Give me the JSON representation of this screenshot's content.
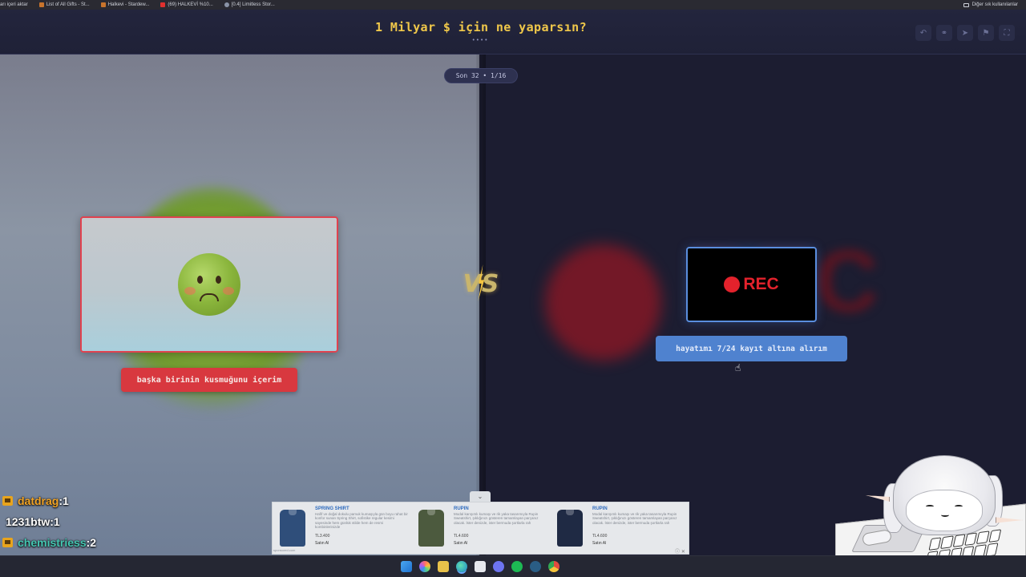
{
  "bookmarks": {
    "items": [
      "arı içeri aktar",
      "List of All Gifts - St...",
      "Halkevi - Stardew...",
      "(69) HALKEVİ %10...",
      "[0.4] Limitless Stor..."
    ],
    "other_label": "Diğer sık kullanılanlar"
  },
  "header": {
    "title": "1 Milyar $ için ne yaparsın?",
    "dots": "••••",
    "tools": [
      "undo-icon",
      "link-icon",
      "send-icon",
      "flag-icon",
      "fullscreen-icon"
    ],
    "tool_glyphs": [
      "↶",
      "⚭",
      "➤",
      "⚑",
      "⛶"
    ]
  },
  "progress": {
    "label": "Son 32 • 1/16"
  },
  "options": {
    "left": {
      "answer": "başka birinin kusmuğunu içerim",
      "image": "nauseated-face-emoji",
      "accent": "#d8383f"
    },
    "right": {
      "answer": "hayatımı 7/24 kayıt altına alırım",
      "image_text": "REC",
      "accent": "#4f82cf"
    }
  },
  "vs": {
    "label": "VS"
  },
  "chat": {
    "messages": [
      {
        "user": "datdrag",
        "sep": " : ",
        "count": "1",
        "badge": "crown-icon",
        "color": "#f2a425"
      },
      {
        "user": "1231btw",
        "sep": " : ",
        "count": "1",
        "badge": "",
        "color": "#ffffff"
      },
      {
        "user": "chemistriess",
        "sep": " : ",
        "count": "2",
        "badge": "crown-icon",
        "color": "#45c7b2"
      }
    ]
  },
  "ad": {
    "handle": "⌄",
    "items": [
      {
        "brand": "SPRING SHIRT",
        "desc": "Hafif ve doğal dokulu pamuk kumaşıyla gün boyu rahat bir konfor sunan Spring Shirt, sofistike regular kesimi sayesinde hem günlük stilde hem de resmi kombinlerinizde",
        "price": "TL3.400",
        "buy": "Satın Al",
        "color": "#2f4e7a"
      },
      {
        "brand": "RUPIN",
        "desc": "Modal karışımlı kumaşı ve rik yaka tasarımıyla Rupin Sweatshirt, şıklığınızı gösteren tamamlayan parçanız olacak. İster denizde, ister bermuda şortlarla rah",
        "price": "TL4.600",
        "buy": "Satın Al",
        "color": "#4c5a3e"
      },
      {
        "brand": "RUPIN",
        "desc": "Modal karışımlı kumaşı ve rik yaka tasarımıyla Rupin Sweatshirt, şıklığınızı gösteren tamamlayan parçanız olacak. İster denizde, ister bermuda şortlarla rah",
        "price": "TL4.600",
        "buy": "Satın Al",
        "color": "#1f2a44"
      }
    ],
    "footer": "sponsored.com",
    "info": "ⓘ ✕"
  },
  "taskbar": {
    "icons": [
      "windows-start-icon",
      "copilot-icon",
      "file-explorer-icon",
      "edge-icon",
      "store-icon",
      "discord-icon",
      "spotify-icon",
      "steam-icon",
      "chrome-icon"
    ]
  }
}
